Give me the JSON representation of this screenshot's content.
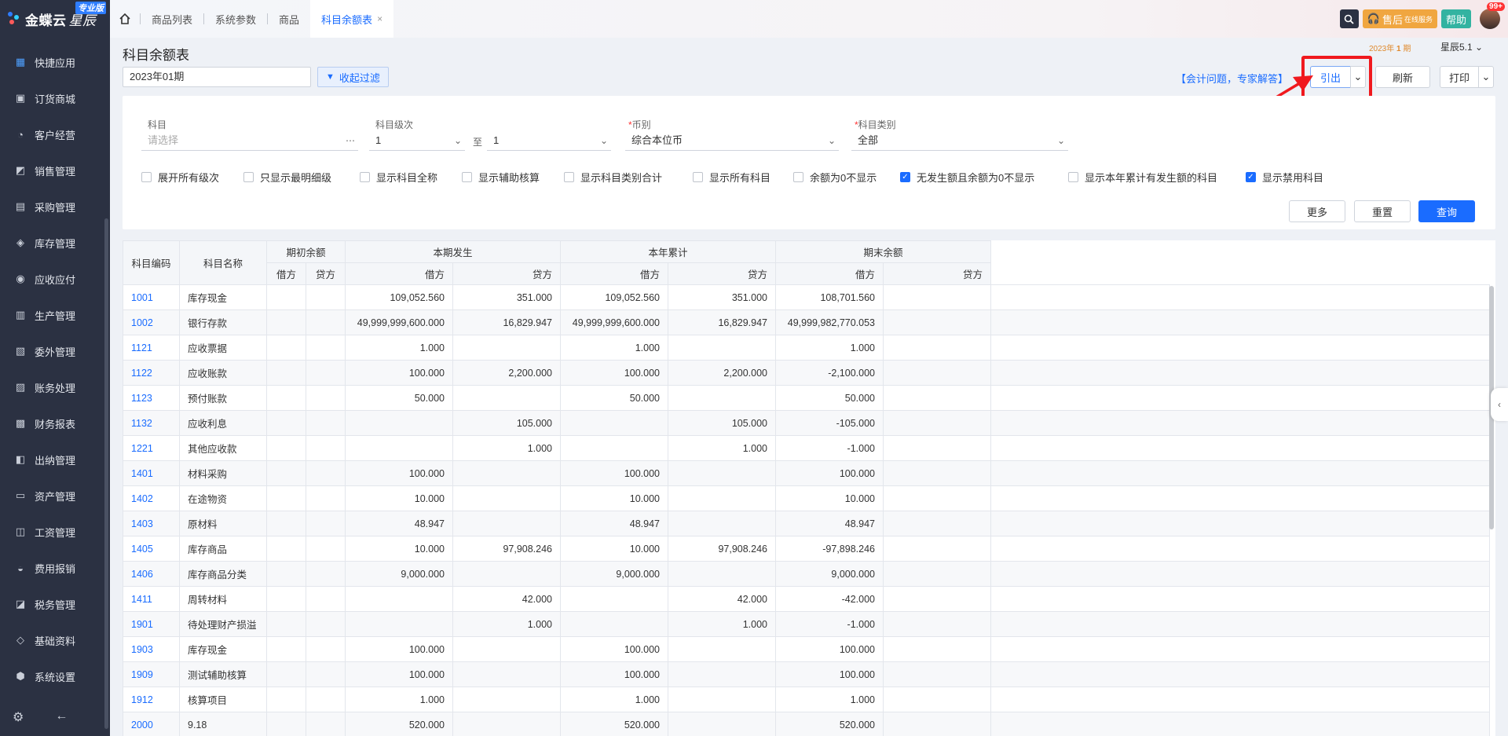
{
  "brand": {
    "name": "金蝶云",
    "sub": "星辰",
    "edition": "专业版"
  },
  "nav": [
    {
      "label": "快捷应用",
      "icon": "grid-icon"
    },
    {
      "label": "订货商城",
      "icon": "shop-bag-icon"
    },
    {
      "label": "客户经营",
      "icon": "customer-icon"
    },
    {
      "label": "销售管理",
      "icon": "chart-icon"
    },
    {
      "label": "采购管理",
      "icon": "cart-icon"
    },
    {
      "label": "库存管理",
      "icon": "box-icon"
    },
    {
      "label": "应收应付",
      "icon": "money-cycle-icon"
    },
    {
      "label": "生产管理",
      "icon": "factory-icon"
    },
    {
      "label": "委外管理",
      "icon": "outsource-icon"
    },
    {
      "label": "账务处理",
      "icon": "ledger-icon"
    },
    {
      "label": "财务报表",
      "icon": "report-icon"
    },
    {
      "label": "出纳管理",
      "icon": "cashier-icon"
    },
    {
      "label": "资产管理",
      "icon": "asset-icon"
    },
    {
      "label": "工资管理",
      "icon": "salary-icon"
    },
    {
      "label": "费用报销",
      "icon": "expense-icon"
    },
    {
      "label": "税务管理",
      "icon": "tax-icon"
    },
    {
      "label": "基础资料",
      "icon": "layers-icon"
    },
    {
      "label": "系统设置",
      "icon": "settings-icon"
    }
  ],
  "tabs": [
    {
      "label": "商品列表"
    },
    {
      "label": "系统参数"
    },
    {
      "label": "商品"
    },
    {
      "label": "科目余额表",
      "active": true
    }
  ],
  "top": {
    "service": "售后",
    "service_small": "在线服务",
    "help": "帮助",
    "badge": "99+"
  },
  "header": {
    "title": "科目余额表",
    "period": "2023年01期",
    "filter_toggle": "收起过滤",
    "period_info_prefix": "2023年",
    "period_info_num": "1",
    "period_info_suffix": "期",
    "version": "星辰5.1",
    "expert_link": "【会计问题，专家解答】",
    "export": "引出",
    "refresh": "刷新",
    "print": "打印"
  },
  "filters": {
    "subject_label": "科目",
    "subject_placeholder": "请选择",
    "level_label": "科目级次",
    "level_from": "1",
    "level_to_label": "至",
    "level_to": "1",
    "currency_label": "币别",
    "currency_value": "综合本位币",
    "type_label": "科目类别",
    "type_value": "全部",
    "checkboxes": [
      {
        "label": "展开所有级次",
        "checked": false
      },
      {
        "label": "只显示最明细级",
        "checked": false
      },
      {
        "label": "显示科目全称",
        "checked": false
      },
      {
        "label": "显示辅助核算",
        "checked": false
      },
      {
        "label": "显示科目类别合计",
        "checked": false
      },
      {
        "label": "显示所有科目",
        "checked": false
      },
      {
        "label": "余额为0不显示",
        "checked": false
      },
      {
        "label": "无发生额且余额为0不显示",
        "checked": true
      },
      {
        "label": "显示本年累计有发生额的科目",
        "checked": false
      },
      {
        "label": "显示禁用科目",
        "checked": true
      }
    ],
    "more": "更多",
    "reset": "重置",
    "query": "查询"
  },
  "table": {
    "h_code": "科目编码",
    "h_name": "科目名称",
    "h_opening": "期初余额",
    "h_period": "本期发生",
    "h_year": "本年累计",
    "h_closing": "期末余额",
    "h_debit": "借方",
    "h_credit": "贷方",
    "rows": [
      [
        "1001",
        "库存现金",
        "",
        "",
        "109,052.560",
        "351.000",
        "109,052.560",
        "351.000",
        "108,701.560",
        ""
      ],
      [
        "1002",
        "银行存款",
        "",
        "",
        "49,999,999,600.000",
        "16,829.947",
        "49,999,999,600.000",
        "16,829.947",
        "49,999,982,770.053",
        ""
      ],
      [
        "1121",
        "应收票据",
        "",
        "",
        "1.000",
        "",
        "1.000",
        "",
        "1.000",
        ""
      ],
      [
        "1122",
        "应收账款",
        "",
        "",
        "100.000",
        "2,200.000",
        "100.000",
        "2,200.000",
        "-2,100.000",
        ""
      ],
      [
        "1123",
        "预付账款",
        "",
        "",
        "50.000",
        "",
        "50.000",
        "",
        "50.000",
        ""
      ],
      [
        "1132",
        "应收利息",
        "",
        "",
        "",
        "105.000",
        "",
        "105.000",
        "-105.000",
        ""
      ],
      [
        "1221",
        "其他应收款",
        "",
        "",
        "",
        "1.000",
        "",
        "1.000",
        "-1.000",
        ""
      ],
      [
        "1401",
        "材料采购",
        "",
        "",
        "100.000",
        "",
        "100.000",
        "",
        "100.000",
        ""
      ],
      [
        "1402",
        "在途物资",
        "",
        "",
        "10.000",
        "",
        "10.000",
        "",
        "10.000",
        ""
      ],
      [
        "1403",
        "原材料",
        "",
        "",
        "48.947",
        "",
        "48.947",
        "",
        "48.947",
        ""
      ],
      [
        "1405",
        "库存商品",
        "",
        "",
        "10.000",
        "97,908.246",
        "10.000",
        "97,908.246",
        "-97,898.246",
        ""
      ],
      [
        "1406",
        "库存商品分类",
        "",
        "",
        "9,000.000",
        "",
        "9,000.000",
        "",
        "9,000.000",
        ""
      ],
      [
        "1411",
        "周转材料",
        "",
        "",
        "",
        "42.000",
        "",
        "42.000",
        "-42.000",
        ""
      ],
      [
        "1901",
        "待处理财产损溢",
        "",
        "",
        "",
        "1.000",
        "",
        "1.000",
        "-1.000",
        ""
      ],
      [
        "1903",
        "库存现金",
        "",
        "",
        "100.000",
        "",
        "100.000",
        "",
        "100.000",
        ""
      ],
      [
        "1909",
        "测试辅助核算",
        "",
        "",
        "100.000",
        "",
        "100.000",
        "",
        "100.000",
        ""
      ],
      [
        "1912",
        "核算项目",
        "",
        "",
        "1.000",
        "",
        "1.000",
        "",
        "1.000",
        ""
      ],
      [
        "2000",
        "9.18",
        "",
        "",
        "520.000",
        "",
        "520.000",
        "",
        "520.000",
        ""
      ]
    ]
  },
  "colors": {
    "sidebar": "#2b3142",
    "accent": "#1a6cff",
    "highlight": "#f0191e"
  }
}
